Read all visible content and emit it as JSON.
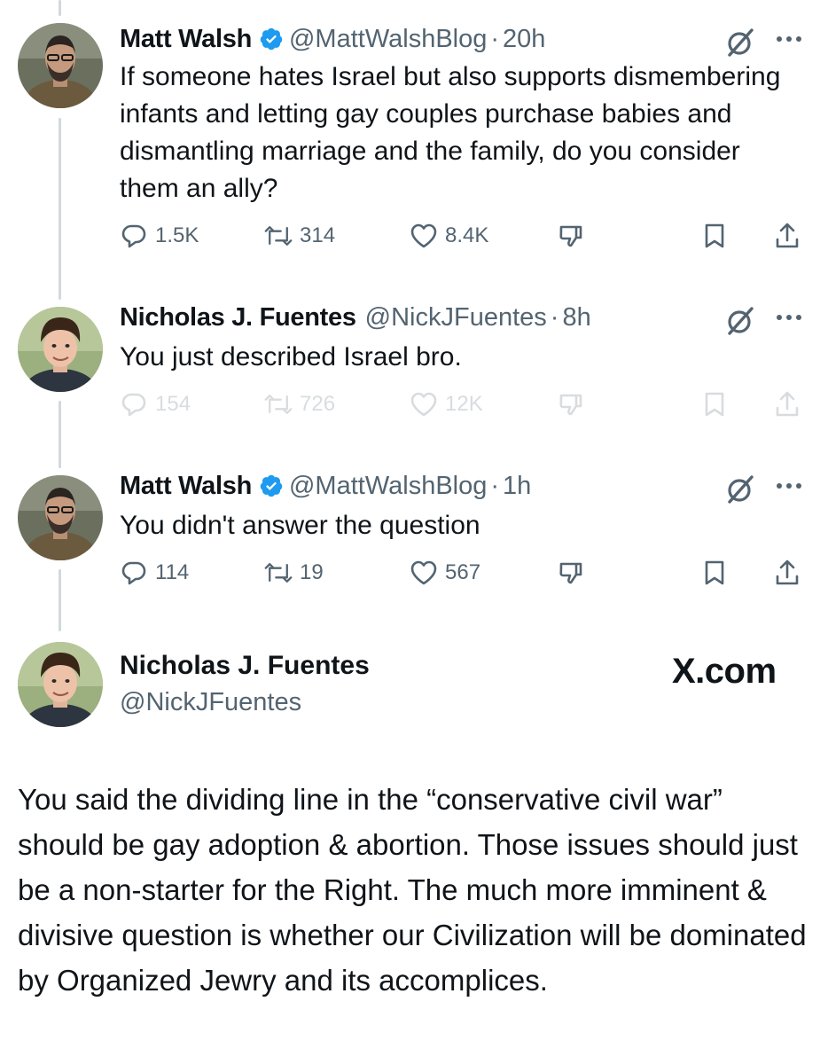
{
  "tweets": [
    {
      "name": "Matt Walsh",
      "handle": "@MattWalshBlog",
      "sep": "·",
      "time": "20h",
      "text": "If someone hates Israel but also supports dismembering infants and letting gay couples purchase babies and dismantling marriage and the family, do you consider them an ally?",
      "replies": "1.5K",
      "reposts": "314",
      "likes": "8.4K"
    },
    {
      "name": "Nicholas J. Fuentes",
      "handle": "@NickJFuentes",
      "sep": "·",
      "time": "8h",
      "text": "You just described Israel bro.",
      "replies": "154",
      "reposts": "726",
      "likes": "12K"
    },
    {
      "name": "Matt Walsh",
      "handle": "@MattWalshBlog",
      "sep": "·",
      "time": "1h",
      "text": "You didn't answer the question",
      "replies": "114",
      "reposts": "19",
      "likes": "567"
    }
  ],
  "quoted": {
    "name": "Nicholas J. Fuentes",
    "handle": "@NickJFuentes",
    "brand": "X.com",
    "text": "You said the dividing line in the “conservative civil war” should be gay adoption & abortion. Those issues should just be a non-starter for the Right. The much more imminent & divisive question is whether our Civilization will be dominated by Organized Jewry and its accomplices."
  },
  "colors": {
    "verified": "#1d9bf0",
    "muted": "#536471",
    "thread_line": "#cfd9de"
  },
  "icons": [
    "verified-badge-icon",
    "grok-icon",
    "more-icon",
    "reply-icon",
    "repost-icon",
    "like-icon",
    "downvote-icon",
    "bookmark-icon",
    "share-icon"
  ]
}
